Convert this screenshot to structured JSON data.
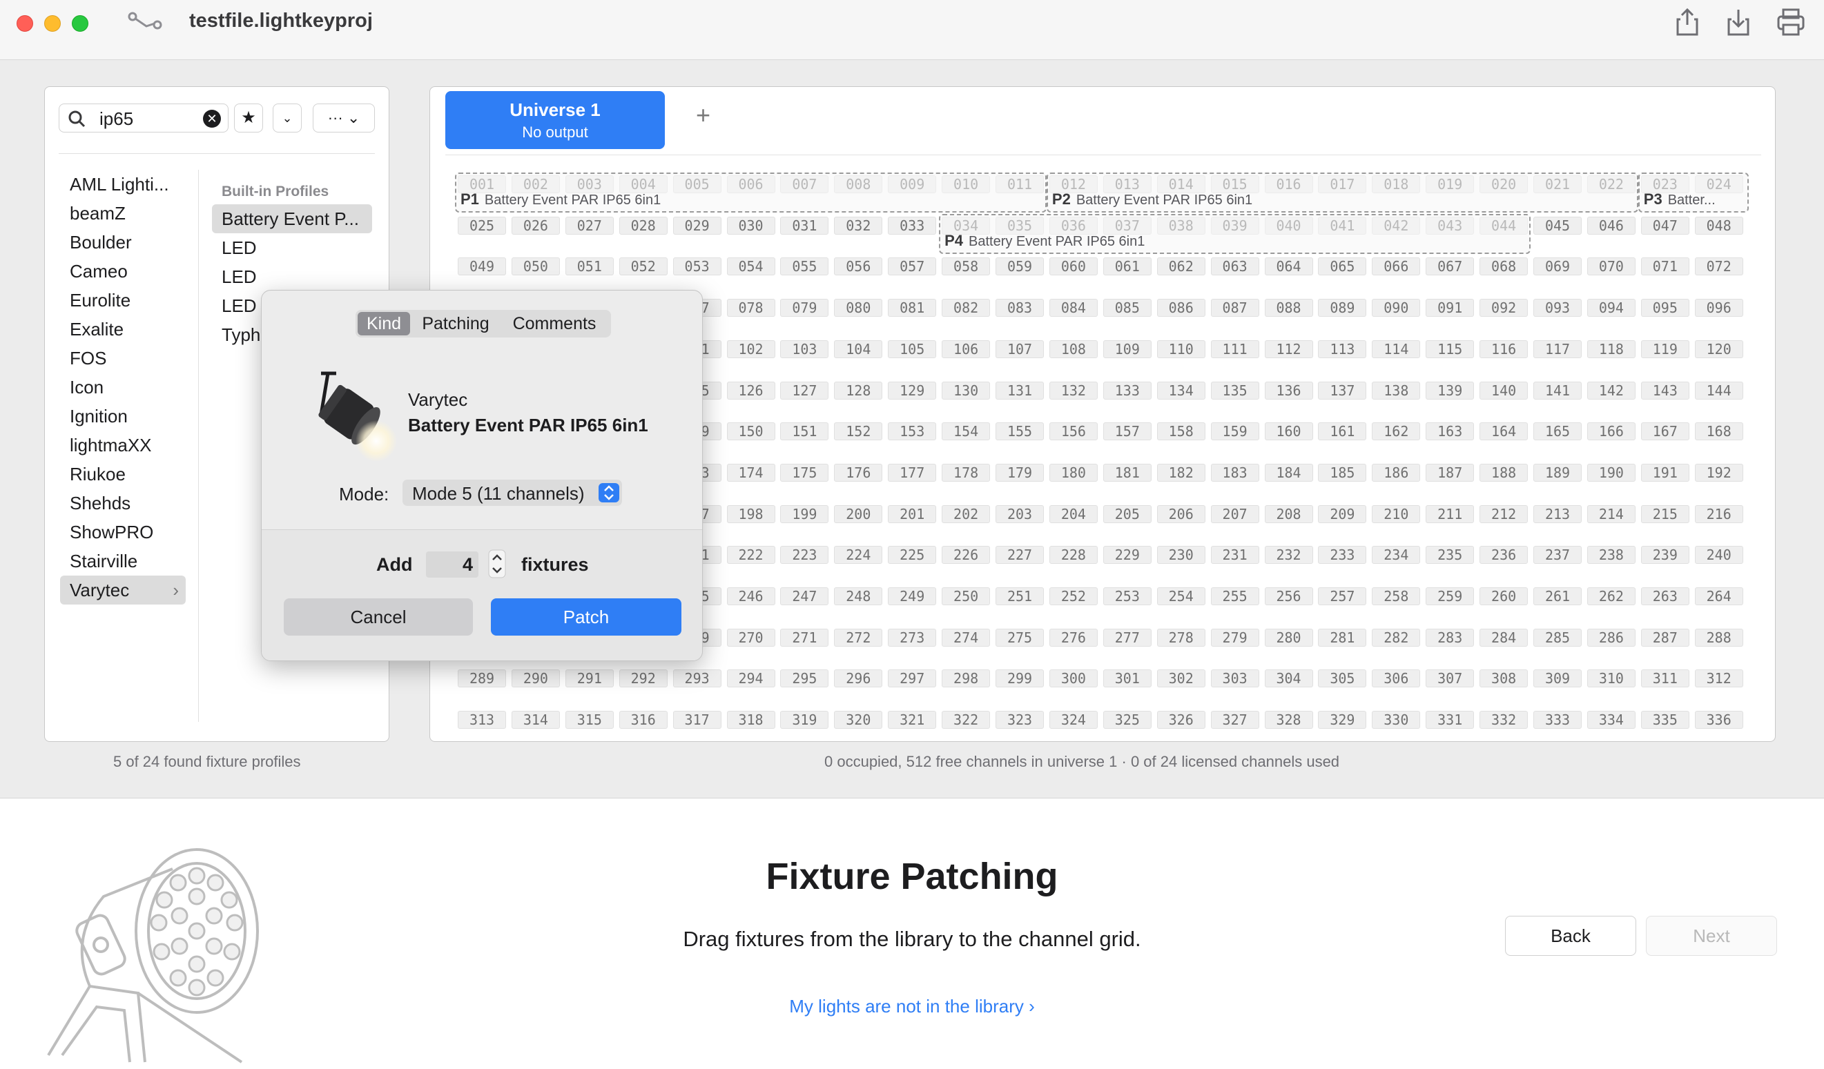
{
  "window": {
    "title": "testfile.lightkeyproj"
  },
  "library": {
    "search_value": "ip65",
    "manufacturers": [
      "AML Lighti...",
      "beamZ",
      "Boulder",
      "Cameo",
      "Eurolite",
      "Exalite",
      "FOS",
      "Icon",
      "Ignition",
      "lightmaXX",
      "Riukoe",
      "Shehds",
      "ShowPRO",
      "Stairville",
      "Varytec"
    ],
    "selected_manufacturer": "Varytec",
    "profiles_header": "Built-in Profiles",
    "profiles": [
      "Battery Event P...",
      "LED",
      "LED",
      "LED",
      "Typh"
    ],
    "status": "5 of 24 found fixture profiles"
  },
  "universe": {
    "tab_name": "Universe 1",
    "tab_output": "No output",
    "add_symbol": "+",
    "status": "0 occupied, 512 free channels in universe 1  ·  0 of 24 licensed channels used"
  },
  "patched_fixtures": [
    {
      "id": "P1",
      "name": "Battery Event PAR IP65 6in1",
      "start": 1
    },
    {
      "id": "P2",
      "name": "Battery Event PAR IP65 6in1",
      "start": 12
    },
    {
      "id": "P3",
      "name": "Batter...",
      "start": 23
    },
    {
      "id": "P4",
      "name": "Battery Event PAR IP65 6in1",
      "start": 34
    }
  ],
  "popover": {
    "tabs": [
      "Kind",
      "Patching",
      "Comments"
    ],
    "selected_tab": "Kind",
    "fixture_manufacturer": "Varytec",
    "fixture_name": "Battery Event PAR IP65 6in1",
    "mode_label": "Mode:",
    "mode_value": "Mode 5 (11 channels)",
    "add_label": "Add",
    "count": "4",
    "fixtures_label": "fixtures",
    "cancel_label": "Cancel",
    "patch_label": "Patch",
    "accent_color": "#2f7ef5"
  },
  "assistant": {
    "title": "Fixture Patching",
    "subtitle": "Drag fixtures from the library to the channel grid.",
    "link": "My lights are not in the library  ›",
    "back_label": "Back",
    "next_label": "Next"
  }
}
